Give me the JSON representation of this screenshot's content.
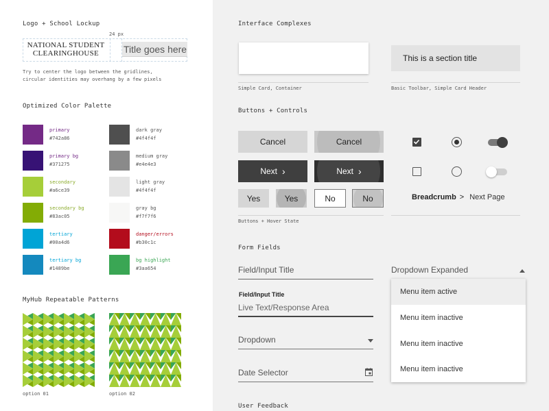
{
  "logo_section": {
    "title": "Logo + School Lockup",
    "spacing_label": "24 px",
    "logo_line1": "NATIONAL STUDENT",
    "logo_line2": "CLEARINGHOUSE",
    "title_placeholder": "Title goes here",
    "note_line1": "Try to center the logo between the gridlines,",
    "note_line2": "circular identities may overhang by a few pixels"
  },
  "palette": {
    "title": "Optimized Color Palette",
    "colors": [
      {
        "name": "primary",
        "hex": "#742a86",
        "label_color": "#742a86"
      },
      {
        "name": "primary bg",
        "hex": "#371275",
        "label_color": "#742a86"
      },
      {
        "name": "secondary",
        "hex": "#a6ce39",
        "label_color": "#8aab2a"
      },
      {
        "name": "secondary bg",
        "hex": "#83ac05",
        "label_color": "#8aab2a"
      },
      {
        "name": "tertiary",
        "hex": "#00a4d6",
        "label_color": "#00a4d6"
      },
      {
        "name": "tertiary bg",
        "hex": "#1489be",
        "label_color": "#00a4d6"
      },
      {
        "name": "dark gray",
        "hex": "#4f4f4f",
        "label_color": "#555555"
      },
      {
        "name": "medium gray",
        "hex": "#e4e4e3",
        "label_color": "#555555",
        "swatch": "#8a8a8a"
      },
      {
        "name": "light gray",
        "hex": "#4f4f4f",
        "label_color": "#555555",
        "swatch": "#e4e4e4"
      },
      {
        "name": "gray bg",
        "hex": "#f7f7f6",
        "label_color": "#555555"
      },
      {
        "name": "danger/errors",
        "hex": "#b30c1c",
        "label_color": "#b30c1c"
      },
      {
        "name": "bg highlight",
        "hex": "#3aa654",
        "label_color": "#3aa654"
      }
    ]
  },
  "patterns": {
    "title": "MyHub Repeatable Patterns",
    "option1": "option 01",
    "option2": "option 02"
  },
  "interface": {
    "title": "Interface Complexes",
    "card_caption": "Simple Card, Container",
    "toolbar_title": "This is a section title",
    "toolbar_caption": "Basic Toolbar, Simple Card Header"
  },
  "buttons": {
    "title": "Buttons + Controls",
    "cancel": "Cancel",
    "next": "Next",
    "next_chevron": "›",
    "yes": "Yes",
    "no": "No",
    "breadcrumb": "Breadcrumb",
    "breadcrumb_sep": ">",
    "next_page": "Next Page",
    "caption": "Buttons + Hover State"
  },
  "form": {
    "title": "Form Fields",
    "field_input_title": "Field/Input Title",
    "field_label_small": "Field/Input Title",
    "live_text": "Live Text/Response Area",
    "dropdown": "Dropdown",
    "date_selector": "Date Selector",
    "dropdown_expanded": "Dropdown Expanded",
    "menu_items": [
      "Menu item active",
      "Menu item inactive",
      "Menu item inactive",
      "Menu item inactive"
    ]
  },
  "feedback": {
    "title": "User Feedback"
  }
}
